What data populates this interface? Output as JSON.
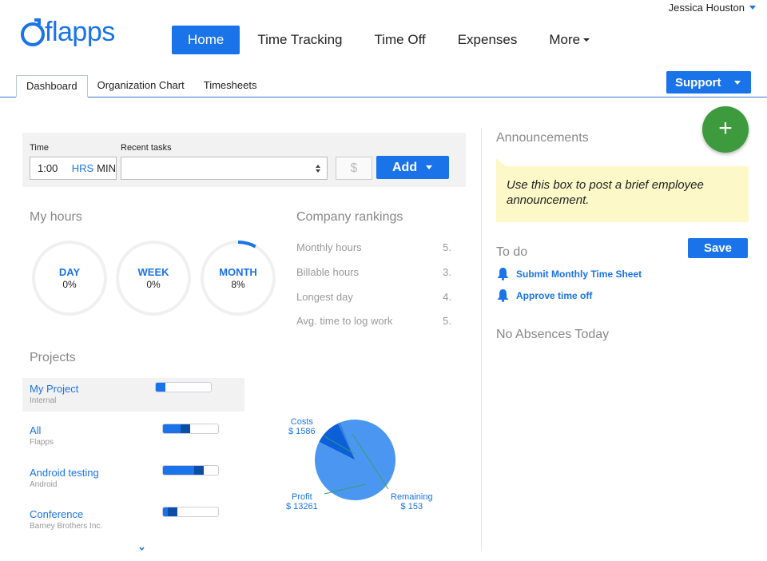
{
  "user": {
    "name": "Jessica Houston"
  },
  "logo": {
    "text": "flapps"
  },
  "nav": {
    "items": [
      {
        "label": "Home",
        "active": true
      },
      {
        "label": "Time Tracking",
        "active": false
      },
      {
        "label": "Time Off",
        "active": false
      },
      {
        "label": "Expenses",
        "active": false
      },
      {
        "label": "More",
        "active": false
      }
    ]
  },
  "subtabs": [
    {
      "label": "Dashboard",
      "active": true
    },
    {
      "label": "Organization Chart",
      "active": false
    },
    {
      "label": "Timesheets",
      "active": false
    }
  ],
  "support": {
    "label": "Support"
  },
  "time_entry": {
    "time_label": "Time",
    "time_value": "1:00",
    "unit_hrs": "HRS",
    "unit_min": "MIN",
    "recent_tasks_label": "Recent tasks",
    "recent_tasks_value": "",
    "currency_symbol": "$",
    "add_label": "Add"
  },
  "my_hours": {
    "title": "My hours",
    "circles": [
      {
        "label": "DAY",
        "percent_text": "0%",
        "percent": 0
      },
      {
        "label": "WEEK",
        "percent_text": "0%",
        "percent": 0
      },
      {
        "label": "MONTH",
        "percent_text": "8%",
        "percent": 8
      }
    ]
  },
  "company_rankings": {
    "title": "Company rankings",
    "rows": [
      {
        "label": "Monthly hours",
        "rank": "5."
      },
      {
        "label": "Billable hours",
        "rank": "3."
      },
      {
        "label": "Longest day",
        "rank": "4."
      },
      {
        "label": "Avg. time to log work",
        "rank": "5."
      }
    ]
  },
  "projects": {
    "title": "Projects",
    "items": [
      {
        "name": "My Project",
        "client": "Internal",
        "progress": 0.18,
        "overrun": 0.0,
        "selected": true
      },
      {
        "name": "All",
        "client": "Flapps",
        "progress": 0.32,
        "overrun": 0.18,
        "selected": false
      },
      {
        "name": "Android testing",
        "client": "Android",
        "progress": 0.56,
        "overrun": 0.18,
        "selected": false
      },
      {
        "name": "Conference",
        "client": "Barney Brothers Inc.",
        "progress": 0.08,
        "overrun": 0.18,
        "selected": false
      }
    ]
  },
  "budget_pie": {
    "slices": [
      {
        "label": "Costs",
        "value": "$ 1586",
        "amount": 1586,
        "color": "#0b5fd8"
      },
      {
        "label": "Remaining",
        "value": "$ 153",
        "amount": 153,
        "color": "#2f7fd8"
      },
      {
        "label": "Profit",
        "value": "$ 13261",
        "amount": 13261,
        "color": "#4a96f0"
      }
    ]
  },
  "announcements": {
    "title": "Announcements",
    "text": "Use this box to post a brief employee announcement."
  },
  "todo": {
    "title": "To do",
    "save_label": "Save",
    "items": [
      {
        "label": "Submit Monthly Time Sheet"
      },
      {
        "label": "Approve time off"
      }
    ]
  },
  "absences": {
    "text": "No Absences Today"
  },
  "colors": {
    "accent": "#1a73e8",
    "fab": "#3d9a3d",
    "announce_bg": "#fdf8c8"
  },
  "icons": {
    "fab": "plus-icon",
    "todo": "bell-icon",
    "more": "chevron-down-icon"
  }
}
